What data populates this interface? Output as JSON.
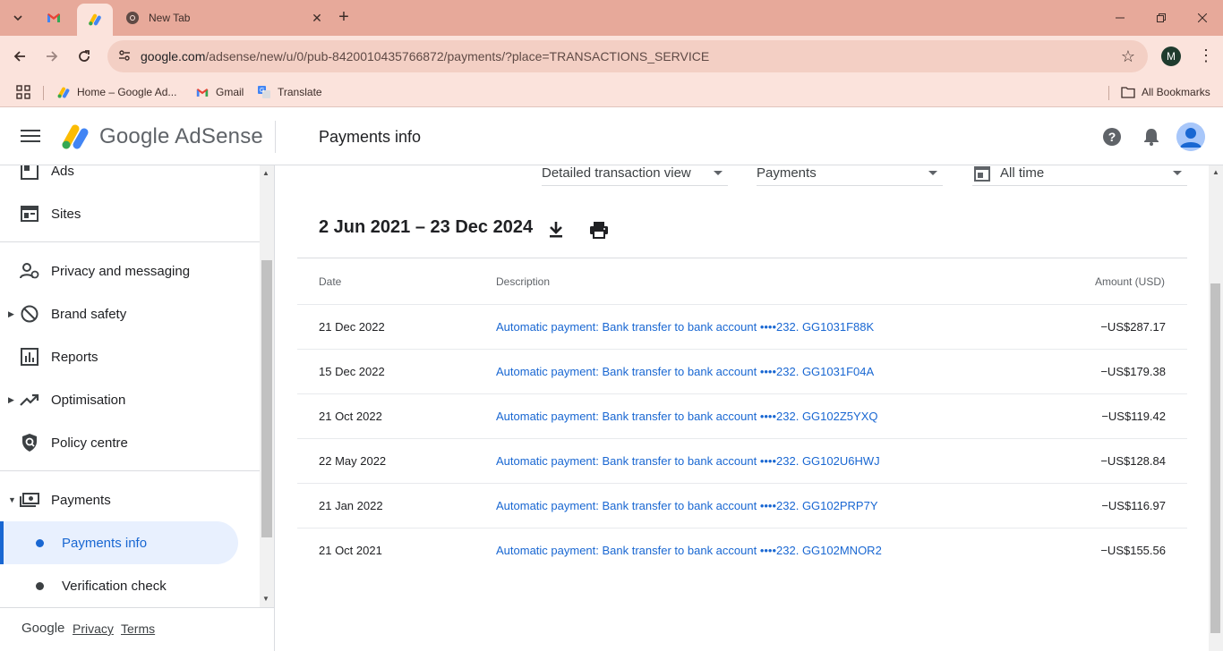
{
  "browser": {
    "tabs": [
      {
        "name": "Gmail",
        "icon": "gmail-icon"
      },
      {
        "name": "AdSense",
        "icon": "adsense-icon",
        "active": true
      },
      {
        "title": "New Tab",
        "icon": "chrome-icon"
      }
    ],
    "url_host": "google.com",
    "url_path": "/adsense/new/u/0/pub-8420010435766872/payments/?place=TRANSACTIONS_SERVICE",
    "profile_initial": "M",
    "bookmarks": [
      {
        "label": "Home – Google Ad...",
        "icon": "adsense-icon"
      },
      {
        "label": "Gmail",
        "icon": "gmail-icon"
      },
      {
        "label": "Translate",
        "icon": "translate-icon"
      }
    ],
    "all_bookmarks": "All Bookmarks"
  },
  "header": {
    "product": "Google AdSense",
    "page_title": "Payments info"
  },
  "sidebar": {
    "items": [
      {
        "label": "Ads",
        "icon": "ads-icon"
      },
      {
        "label": "Sites",
        "icon": "sites-icon"
      },
      {
        "label": "Privacy and messaging",
        "icon": "privacy-icon"
      },
      {
        "label": "Brand safety",
        "icon": "block-icon"
      },
      {
        "label": "Reports",
        "icon": "reports-icon"
      },
      {
        "label": "Optimisation",
        "icon": "trending-icon"
      },
      {
        "label": "Policy centre",
        "icon": "policy-icon"
      },
      {
        "label": "Payments",
        "icon": "payments-icon"
      }
    ],
    "sub_items": [
      {
        "label": "Payments info",
        "active": true
      },
      {
        "label": "Verification check"
      }
    ],
    "footer": {
      "brand": "Google",
      "privacy": "Privacy",
      "terms": "Terms"
    }
  },
  "filters": {
    "view": "Detailed transaction view",
    "type": "Payments",
    "period": "All time"
  },
  "range_title": "2 Jun 2021 – 23 Dec 2024",
  "table": {
    "headers": {
      "date": "Date",
      "description": "Description",
      "amount": "Amount (USD)"
    },
    "rows": [
      {
        "date": "21 Dec 2022",
        "description": "Automatic payment: Bank transfer to bank account  ••••232. GG1031F88K",
        "amount": "−US$287.17"
      },
      {
        "date": "15 Dec 2022",
        "description": "Automatic payment: Bank transfer to bank account  ••••232. GG1031F04A",
        "amount": "−US$179.38"
      },
      {
        "date": "21 Oct 2022",
        "description": "Automatic payment: Bank transfer to bank account  ••••232. GG102Z5YXQ",
        "amount": "−US$119.42"
      },
      {
        "date": "22 May 2022",
        "description": "Automatic payment: Bank transfer to bank account  ••••232. GG102U6HWJ",
        "amount": "−US$128.84"
      },
      {
        "date": "21 Jan 2022",
        "description": "Automatic payment: Bank transfer to bank account  ••••232. GG102PRP7Y",
        "amount": "−US$116.97"
      },
      {
        "date": "21 Oct 2021",
        "description": "Automatic payment: Bank transfer to bank account  ••••232. GG102MNOR2",
        "amount": "−US$155.56"
      }
    ]
  },
  "colors": {
    "chrome_tab": "#e7a99a",
    "chrome_toolbar": "#fbe3dc",
    "link": "#1967d2",
    "active_nav": "#e8f0fe"
  }
}
